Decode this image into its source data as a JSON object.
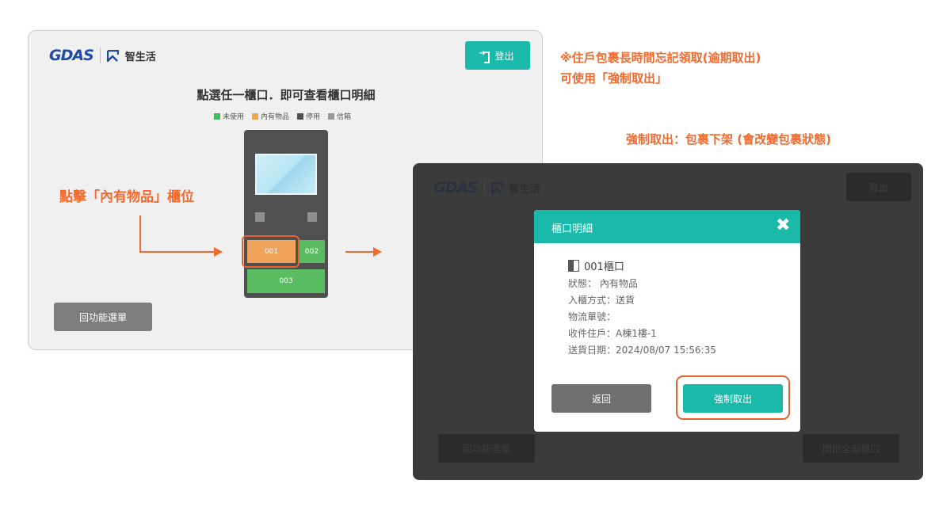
{
  "screen1": {
    "logo": {
      "brand": "GDAS",
      "product": "智生活"
    },
    "logout_label": "登出",
    "title": "點選任一櫃口．即可查看櫃口明細",
    "legend": [
      {
        "label": "未使用",
        "color": "#49b865"
      },
      {
        "label": "內有物品",
        "color": "#f0a35b"
      },
      {
        "label": "停用",
        "color": "#505050"
      },
      {
        "label": "信箱",
        "color": "#9a9a9a"
      }
    ],
    "cells": [
      {
        "label": "001",
        "status": "內有物品",
        "color": "#f0a35b"
      },
      {
        "label": "002",
        "status": "未使用",
        "color": "#5bbd61"
      },
      {
        "label": "003",
        "status": "未使用",
        "color": "#5bbd61"
      }
    ],
    "back_label": "回功能選單"
  },
  "annotations": {
    "click_hint": "點擊「內有物品」櫃位",
    "note_line1": "※住戶包裹長時間忘記領取(逾期取出)",
    "note_line2": "可使用「強制取出」",
    "force_caption": "強制取出：包裹下架 (會改變包裹狀態)"
  },
  "screen2": {
    "logo": {
      "brand": "GDAS",
      "product": "智生活"
    },
    "logout_label": "登出",
    "back_label": "回功能選單",
    "bulk_label": "開啟全部櫃口",
    "modal": {
      "title": "櫃口明細",
      "locker_name": "001櫃口",
      "status": "狀態：  內有物品",
      "entry_method": "入櫃方式：送貨",
      "tracking_no": "物流單號：",
      "recipient": "收件住戶：A棟1樓-1",
      "delivery_date": "送貨日期：2024/08/07 15:56:35",
      "back_label": "返回",
      "force_label": "強制取出"
    }
  },
  "colors": {
    "accent": "#1bb9a9",
    "highlight": "#f26a2e"
  }
}
